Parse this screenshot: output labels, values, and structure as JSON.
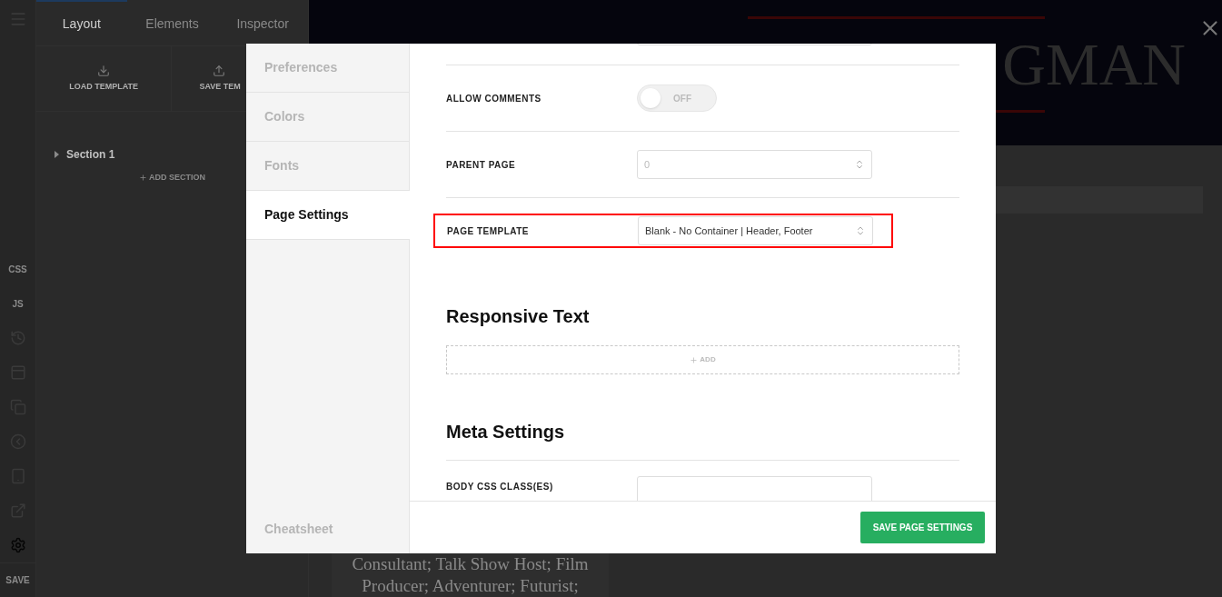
{
  "rail": {
    "code_labels": [
      "CSS",
      "JS"
    ],
    "icons": [
      {
        "selected": false
      },
      {
        "selected": false
      },
      {
        "selected": false
      },
      {
        "selected": false
      },
      {
        "selected": false
      },
      {
        "selected": false
      },
      {
        "selected": true
      }
    ],
    "save": "SAVE"
  },
  "panel": {
    "tabs": [
      {
        "label": "Layout",
        "selected": true
      },
      {
        "label": "Elements",
        "selected": false
      },
      {
        "label": "Inspector",
        "selected": false
      }
    ],
    "actions": [
      {
        "label": "LOAD TEMPLATE",
        "kind": "download"
      },
      {
        "label": "SAVE TEM",
        "kind": "upload"
      }
    ],
    "tree": [
      {
        "label": "Section 1",
        "expanded": false
      }
    ],
    "add_section": "ADD SECTION"
  },
  "preview": {
    "title": "GMAN",
    "bio": [
      "Consultant; Talk Show Host; Film",
      "Producer; Adventurer; Futurist;"
    ]
  },
  "modal": {
    "nav": [
      {
        "label": "Preferences",
        "selected": false
      },
      {
        "label": "Colors",
        "selected": false
      },
      {
        "label": "Fonts",
        "selected": false
      },
      {
        "label": "Page Settings",
        "selected": true
      }
    ],
    "cheatsheet": "Cheatsheet",
    "settings": [
      {
        "kind": "toggle",
        "label": "ALLOW COMMENTS",
        "on": false,
        "state_text": "OFF",
        "highlighted": false
      },
      {
        "kind": "select",
        "label": "PARENT PAGE",
        "placeholder": "0",
        "highlighted": false
      },
      {
        "kind": "select",
        "label": "PAGE TEMPLATE",
        "value": "Blank - No Container | Header, Footer",
        "highlighted": true
      }
    ],
    "responsive": {
      "heading": "Responsive Text",
      "add": "ADD"
    },
    "meta": {
      "heading": "Meta Settings",
      "fields": [
        {
          "label": "BODY CSS CLASS(ES)"
        }
      ]
    },
    "save_button": "SAVE PAGE SETTINGS"
  }
}
